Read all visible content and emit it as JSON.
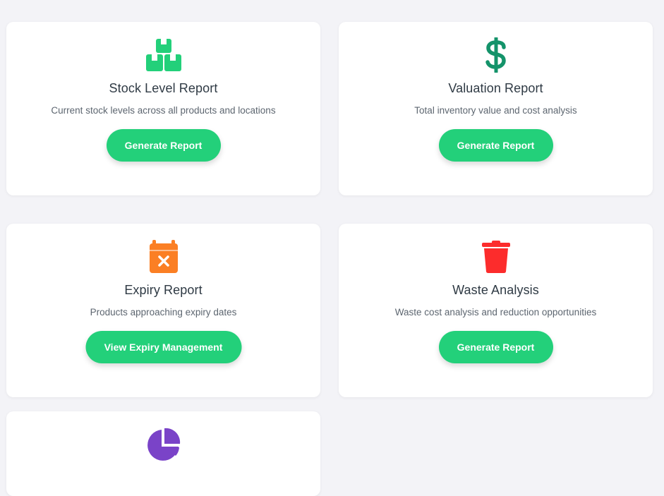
{
  "cards": [
    {
      "icon": "boxes-icon",
      "title": "Stock Level Report",
      "description": "Current stock levels across all products and locations",
      "button": "Generate Report",
      "color": "#23d07a"
    },
    {
      "icon": "dollar-icon",
      "title": "Valuation Report",
      "description": "Total inventory value and cost analysis",
      "button": "Generate Report",
      "color": "#14936a"
    },
    {
      "icon": "calendar-x-icon",
      "title": "Expiry Report",
      "description": "Products approaching expiry dates",
      "button": "View Expiry Management",
      "color": "#fb7f24"
    },
    {
      "icon": "trash-icon",
      "title": "Waste Analysis",
      "description": "Waste cost analysis and reduction opportunities",
      "button": "Generate Report",
      "color": "#fc2c2c"
    },
    {
      "icon": "pie-chart-icon",
      "color": "#7a43c8"
    }
  ],
  "button_color": "#23d07a"
}
